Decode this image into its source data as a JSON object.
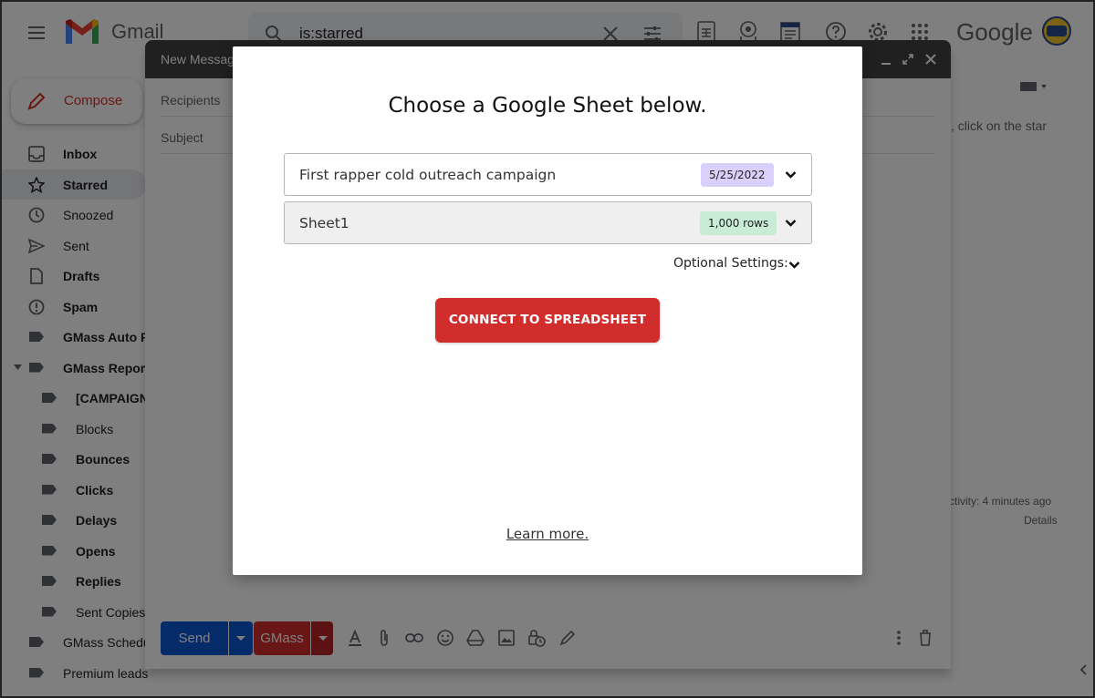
{
  "gmail": {
    "brand": "Gmail",
    "search_query": "is:starred",
    "google_brand": "Google",
    "compose_label": "Compose",
    "nav_items": [
      {
        "label": "Inbox",
        "bold": true
      },
      {
        "label": "Starred",
        "bold": true
      },
      {
        "label": "Snoozed",
        "bold": false
      },
      {
        "label": "Sent",
        "bold": false
      },
      {
        "label": "Drafts",
        "bold": true
      },
      {
        "label": "Spam",
        "bold": true
      },
      {
        "label": "GMass Auto Follow-ups",
        "bold": true
      },
      {
        "label": "GMass Reports",
        "bold": true
      },
      {
        "label": "[CAMPAIGNS]",
        "bold": true
      },
      {
        "label": "Blocks",
        "bold": false
      },
      {
        "label": "Bounces",
        "bold": true
      },
      {
        "label": "Clicks",
        "bold": true
      },
      {
        "label": "Delays",
        "bold": true
      },
      {
        "label": "Opens",
        "bold": true
      },
      {
        "label": "Replies",
        "bold": true
      },
      {
        "label": "Sent Copies",
        "bold": false
      },
      {
        "label": "GMass Scheduled",
        "bold": false
      },
      {
        "label": "Premium leads",
        "bold": false
      }
    ],
    "right_hint": ", click on the star",
    "activity_text": "ctivity: 4 minutes ago",
    "details_link": "Details"
  },
  "compose": {
    "title": "New Message",
    "recipients_label": "Recipients",
    "subject_label": "Subject",
    "send_label": "Send",
    "gmass_label": "GMass"
  },
  "modal": {
    "title": "Choose a Google Sheet below.",
    "spreadsheet": {
      "name": "First rapper cold outreach campaign",
      "date": "5/25/2022"
    },
    "sheet": {
      "name": "Sheet1",
      "rows": "1,000 rows"
    },
    "optional_settings": "Optional Settings:",
    "connect_button": "CONNECT TO SPREADSHEET",
    "learn_more": "Learn more."
  },
  "colors": {
    "gmass_red": "#d12d2d",
    "send_blue": "#0b57d0",
    "date_badge": "#d9d0fb",
    "rows_badge": "#c8ecd6"
  }
}
